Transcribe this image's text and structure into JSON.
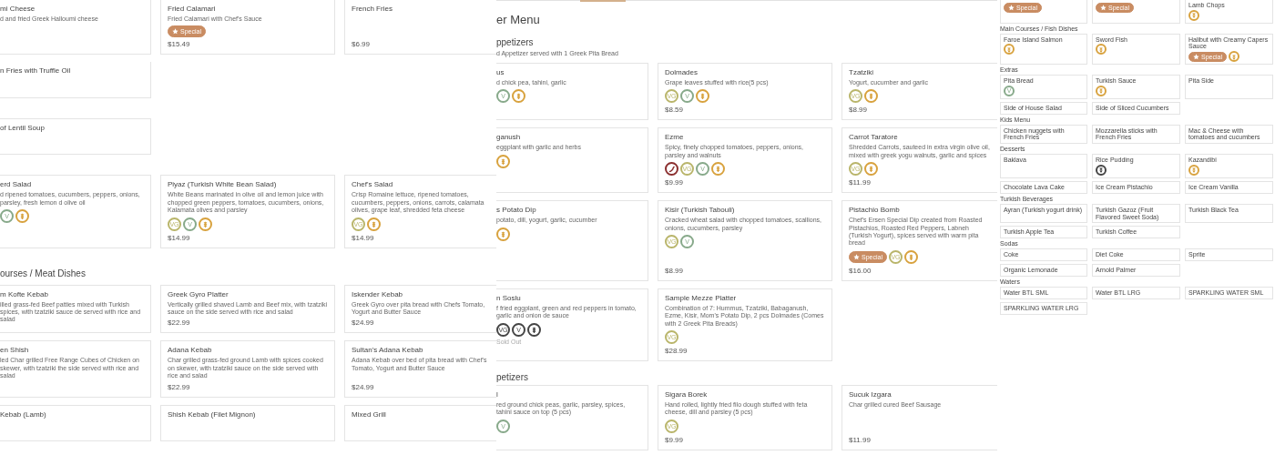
{
  "panels": [
    {
      "kind": "zoomed",
      "sections": [
        {
          "cards": [
            {
              "title": "mi Cheese",
              "description": "d and fried Greek Halloumi cheese"
            },
            {
              "title": "Fried Calamari",
              "description": "Fried Calamari with Chef's Sauce",
              "tags": [
                {
                  "kind": "special",
                  "label": "Special",
                  "color": "#c98c62"
                }
              ],
              "price": "$15.49"
            },
            {
              "title": "French Fries",
              "price": "$6.99"
            },
            {
              "title": "n Fries with Truffle Oil"
            }
          ]
        },
        {
          "cards": [
            {
              "title": "of Lentil Soup"
            }
          ]
        },
        {
          "cards": [
            {
              "title": "erd Salad",
              "description": "d ripened tomatoes, cucumbers, peppers, onions, parsley, fresh lemon d olive oil",
              "tags": [
                {
                  "kind": "label",
                  "label": "V",
                  "color": "#87a98a"
                },
                {
                  "kind": "gluten-free",
                  "color": "#d8a23e"
                }
              ]
            },
            {
              "title": "Piyaz (Turkish White Bean Salad)",
              "description": "White Beans marinated in olive oil and lemon juice with chopped green peppers, tomatoes, cucumbers, onions, Kalamata olives and parsley",
              "tags": [
                {
                  "kind": "label",
                  "label": "VG",
                  "color": "#b9b56a"
                },
                {
                  "kind": "label",
                  "label": "V",
                  "color": "#87a98a"
                },
                {
                  "kind": "gluten-free",
                  "color": "#d8a23e"
                }
              ],
              "price": "$14.99"
            },
            {
              "title": "Chef's Salad",
              "description": "Crisp Romaine lettuce, ripened tomatoes, cucumbers, peppers, onions, carrots, calamata olives, grape leaf, shredded feta cheese",
              "tags": [
                {
                  "kind": "label",
                  "label": "VG",
                  "color": "#b9b56a"
                },
                {
                  "kind": "gluten-free",
                  "color": "#d8a23e"
                }
              ],
              "price": "$14.99"
            }
          ]
        },
        {
          "heading": "ourses / Meat Dishes",
          "cards": [
            {
              "title": "m Kofte Kebab",
              "description": "illed grass-fed Beef patties mixed with Turkish spices, with tzatziki sauce de served with rice and salad"
            },
            {
              "title": "Greek Gyro Platter",
              "description": "Vertically grilled shaved Lamb and Beef mix, with tzatziki sauce on the side served with rice and salad",
              "price": "$22.99"
            },
            {
              "title": "Iskender Kebab",
              "description": "Greek Gyro over pita bread with Chefs Tomato, Yogurt and Butter Sauce",
              "price": "$24.99"
            },
            {
              "title": "en Shish",
              "description": "led Char grilled Free Range Cubes of Chicken on skewer, with tzatziki the side served with rice and salad"
            },
            {
              "title": "Adana Kebab",
              "description": "Char grilled grass-fed ground Lamb with spices cooked on skewer, with tzatziki sauce on the side served with rice and salad",
              "price": "$22.99"
            },
            {
              "title": "Sultan's Adana Kebab",
              "description": "Adana Kebab over bed of pita bread with Chef's Tomato, Yogurt and Butter Sauce",
              "price": "$24.99"
            },
            {
              "title": "Kebab (Lamb)"
            },
            {
              "title": "Shish Kebab (Filet Mignon)"
            },
            {
              "title": "Mixed Grill"
            }
          ]
        }
      ]
    },
    {
      "kind": "zoomed",
      "page_title": "er Menu",
      "sections": [
        {
          "heading": "ppetizers",
          "subtitle": "d Appetizer served with 1 Greek Pita Bread",
          "cards": [
            {
              "title": "us",
              "description": "d chick pea, tahini, garlic",
              "tags": [
                {
                  "kind": "label",
                  "label": "V",
                  "color": "#87a98a"
                },
                {
                  "kind": "gluten-free",
                  "color": "#d8a23e"
                }
              ]
            },
            {
              "title": "Dolmades",
              "description": "Grape leaves stuffed with rice(5 pcs)",
              "tags": [
                {
                  "kind": "label",
                  "label": "VG",
                  "color": "#b9b56a"
                },
                {
                  "kind": "label",
                  "label": "V",
                  "color": "#87a98a"
                },
                {
                  "kind": "gluten-free",
                  "color": "#d8a23e"
                }
              ],
              "price": "$8.59"
            },
            {
              "title": "Tzatziki",
              "description": "Yogurt, cucumber and garlic",
              "tags": [
                {
                  "kind": "label",
                  "label": "VG",
                  "color": "#b9b56a"
                },
                {
                  "kind": "gluten-free",
                  "color": "#d8a23e"
                }
              ],
              "price": "$8.99"
            },
            {
              "title": "ganush",
              "description": "eggplant with garlic and herbs",
              "tags": [
                {
                  "kind": "gluten-free",
                  "color": "#d8a23e"
                }
              ]
            },
            {
              "title": "Ezme",
              "description": "Spicy, finely chopped tomatoes, peppers, onions, parsley and walnuts",
              "tags": [
                {
                  "kind": "spicy",
                  "color": "#8b2f2f"
                },
                {
                  "kind": "label",
                  "label": "VG",
                  "color": "#b9b56a"
                },
                {
                  "kind": "label",
                  "label": "V",
                  "color": "#87a98a"
                },
                {
                  "kind": "gluten-free",
                  "color": "#d8a23e"
                }
              ],
              "price": "$9.99"
            },
            {
              "title": "Carrot Taratore",
              "description": "Shredded Carrots, sauteed in extra virgin olive oil, mixed with greek yogu walnuts, garlic and spices",
              "tags": [
                {
                  "kind": "label",
                  "label": "VG",
                  "color": "#b9b56a"
                },
                {
                  "kind": "gluten-free",
                  "color": "#d8a23e"
                }
              ],
              "price": "$11.99"
            },
            {
              "title": "s Potato Dip",
              "description": "potato, dill, yogurt, garlic, cucumber",
              "tags": [
                {
                  "kind": "gluten-free",
                  "color": "#d8a23e"
                }
              ]
            },
            {
              "title": "Kisir (Turkish Tabouli)",
              "description": "Cracked wheat salad with chopped tomatoes, scallions, onions, cucumbers, parsley",
              "tags": [
                {
                  "kind": "label",
                  "label": "VG",
                  "color": "#b9b56a"
                },
                {
                  "kind": "label",
                  "label": "V",
                  "color": "#87a98a"
                }
              ],
              "price": "$8.99"
            },
            {
              "title": "Pistachio Bomb",
              "description": "Chef's Ersen Special Dip created from Roasted Pistachios, Roasted Red Peppers, Labneh (Turkish Yogurt), spices served with warm pita bread",
              "tags": [
                {
                  "kind": "special",
                  "label": "Special",
                  "color": "#c98c62"
                },
                {
                  "kind": "label",
                  "label": "VG",
                  "color": "#b9b56a"
                },
                {
                  "kind": "gluten-free",
                  "color": "#d8a23e"
                }
              ],
              "price": "$16.00"
            },
            {
              "title": "n Soslu",
              "description": "f fried eggplant, green and red peppers in tomato, garlic and onion de sauce",
              "tags": [
                {
                  "kind": "label",
                  "label": "VG",
                  "color": "#444444"
                },
                {
                  "kind": "label",
                  "label": "V",
                  "color": "#444444"
                },
                {
                  "kind": "gluten-free",
                  "color": "#444444"
                }
              ],
              "status": "Sold Out"
            },
            {
              "title": "Sample Mezze Platter",
              "description": "Combination of 7: Hummus, Tzatziki, Babaganush, Ezme, Kisir, Mom's Potato Dip, 2 pcs Dolmades (Comes with 2 Greek Pita Breads)",
              "tags": [
                {
                  "kind": "label",
                  "label": "VG",
                  "color": "#b9b56a"
                }
              ],
              "price": "$28.99"
            }
          ]
        },
        {
          "heading": "petizers",
          "cards": [
            {
              "title": "l",
              "description": "red ground chick peas, garlic, parsley, spices, tahini sauce on top (5 pcs)",
              "tags": [
                {
                  "kind": "label",
                  "label": "V",
                  "color": "#87a98a"
                }
              ]
            },
            {
              "title": "Sigara Borek",
              "description": "Hand rolled, lightly fried filo dough stuffed with feta cheese, dill and parsley (5 pcs)",
              "tags": [
                {
                  "kind": "label",
                  "label": "VG",
                  "color": "#b9b56a"
                }
              ],
              "price": "$9.99"
            },
            {
              "title": "Sucuk Izgara",
              "description": "Char grilled cured Beef Sausage",
              "price": "$11.99"
            }
          ]
        }
      ]
    },
    {
      "kind": "overview",
      "sections": [
        {
          "cards": [
            {
              "tags": [
                {
                  "kind": "special",
                  "label": "Special",
                  "color": "#c98c62"
                }
              ]
            },
            {
              "tags": [
                {
                  "kind": "special",
                  "label": "Special",
                  "color": "#c98c62"
                }
              ]
            },
            {
              "title": "Lamb Chops",
              "tags": [
                {
                  "kind": "gluten-free",
                  "color": "#d8a23e"
                }
              ]
            }
          ]
        },
        {
          "heading": "Main Courses / Fish Dishes",
          "cards": [
            {
              "title": "Faroe Island Salmon",
              "tags": [
                {
                  "kind": "gluten-free",
                  "color": "#d8a23e"
                }
              ]
            },
            {
              "title": "Sword Fish",
              "tags": [
                {
                  "kind": "gluten-free",
                  "color": "#d8a23e"
                }
              ]
            },
            {
              "title": "Halibut with Creamy Capers Sauce",
              "tags": [
                {
                  "kind": "special",
                  "label": "Special",
                  "color": "#c98c62"
                },
                {
                  "kind": "gluten-free",
                  "color": "#d8a23e"
                }
              ]
            }
          ]
        },
        {
          "heading": "Extras",
          "cards": [
            {
              "title": "Pita Bread",
              "tags": [
                {
                  "kind": "label",
                  "label": "V",
                  "color": "#87a98a"
                }
              ]
            },
            {
              "title": "Turkish Sauce",
              "tags": [
                {
                  "kind": "gluten-free",
                  "color": "#d8a23e"
                }
              ]
            },
            {
              "title": "Pita Side"
            },
            {
              "title": "Side of House Salad"
            },
            {
              "title": "Side of Sliced Cucumbers"
            }
          ]
        },
        {
          "heading": "Kids Menu",
          "cards": [
            {
              "title": "Chicken nuggets with French Fries"
            },
            {
              "title": "Mozzarella sticks with French Fries"
            },
            {
              "title": "Mac & Cheese with tomatoes and cucumbers"
            }
          ]
        },
        {
          "heading": "Desserts",
          "cards": [
            {
              "title": "Baklava"
            },
            {
              "title": "Rice Pudding",
              "tags": [
                {
                  "kind": "gluten-free",
                  "color": "#444444"
                }
              ]
            },
            {
              "title": "Kazandibi",
              "tags": [
                {
                  "kind": "gluten-free",
                  "color": "#d8a23e"
                }
              ]
            },
            {
              "title": "Chocolate Lava Cake"
            },
            {
              "title": "Ice Cream Pistachio"
            },
            {
              "title": "Ice Cream Vanilla"
            }
          ]
        },
        {
          "heading": "Turkish Beverages",
          "cards": [
            {
              "title": "Ayran (Turkish yogurt drink)"
            },
            {
              "title": "Turkish Gazoz (Fruit Flavored Sweet Soda)"
            },
            {
              "title": "Turkish Black Tea"
            },
            {
              "title": "Turkish Apple Tea"
            },
            {
              "title": "Turkish Coffee"
            }
          ]
        },
        {
          "heading": "Sodas",
          "cards": [
            {
              "title": "Coke"
            },
            {
              "title": "Diet Coke"
            },
            {
              "title": "Sprite"
            },
            {
              "title": "Organic Lemonade"
            },
            {
              "title": "Arnold Palmer"
            }
          ]
        },
        {
          "heading": "Waters",
          "cards": [
            {
              "title": "Water BTL SML"
            },
            {
              "title": "Water BTL LRG"
            },
            {
              "title": "SPARKLING WATER SML"
            },
            {
              "title": "SPARKLING WATER LRG"
            }
          ]
        }
      ]
    }
  ]
}
